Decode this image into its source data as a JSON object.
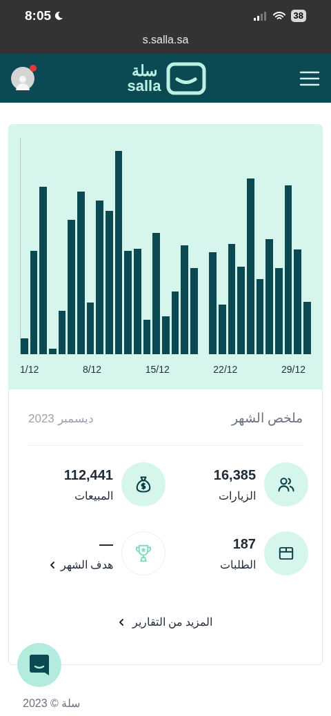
{
  "status_bar": {
    "time": "8:05",
    "battery": "38"
  },
  "browser": {
    "url": "s.salla.sa"
  },
  "header": {
    "logo_arabic": "سلة",
    "logo_latin": "salla",
    "notification": true
  },
  "chart": {
    "x_labels": [
      "29/12",
      "22/12",
      "15/12",
      "8/12",
      "1/12"
    ]
  },
  "summary": {
    "title": "ملخص الشهر",
    "period": "ديسمبر 2023",
    "stats": [
      {
        "kind": "visits",
        "value": "16,385",
        "label": "الزيارات",
        "link": false
      },
      {
        "kind": "sales",
        "value": "112,441",
        "label": "المبيعات",
        "link": false
      },
      {
        "kind": "orders",
        "value": "187",
        "label": "الطلبات",
        "link": false
      },
      {
        "kind": "goal",
        "value": "—",
        "label": "هدف الشهر",
        "link": true
      }
    ],
    "more_link": "المزيد من التقارير"
  },
  "footer": {
    "copyright": "سلة © 2023"
  }
}
